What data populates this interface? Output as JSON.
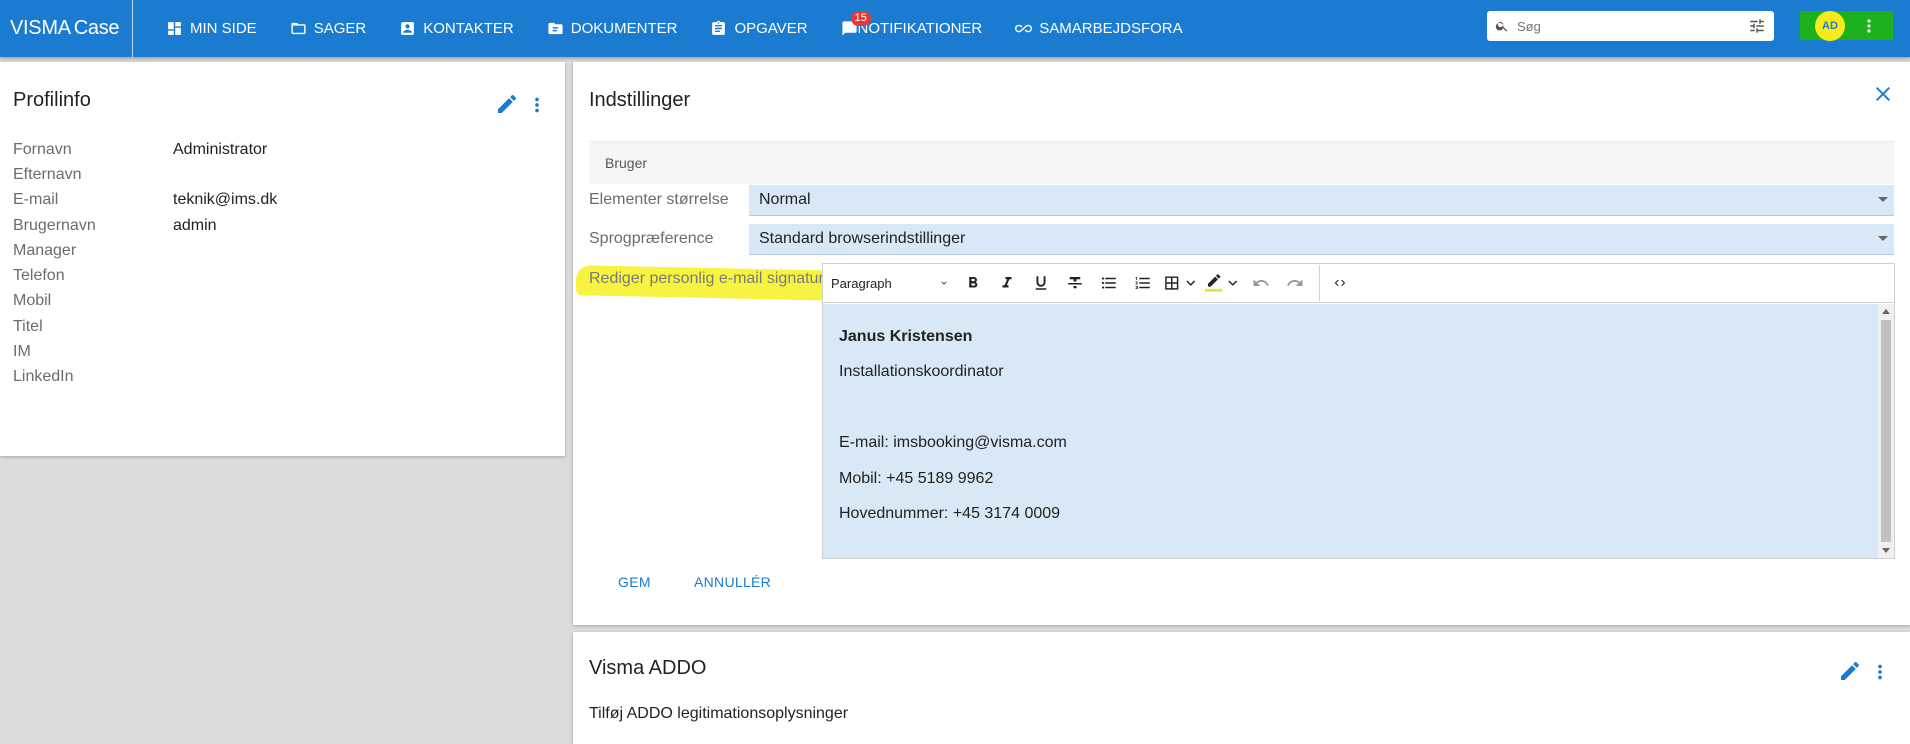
{
  "app": {
    "logo_brand": "VISMA",
    "logo_product": "Case"
  },
  "nav": [
    {
      "label": "MIN SIDE",
      "icon": "dashboard-icon"
    },
    {
      "label": "SAGER",
      "icon": "folder-icon"
    },
    {
      "label": "KONTAKTER",
      "icon": "contact-card-icon"
    },
    {
      "label": "DOKUMENTER",
      "icon": "document-folder-icon"
    },
    {
      "label": "OPGAVER",
      "icon": "clipboard-icon"
    },
    {
      "label": "NOTIFIKATIONER",
      "icon": "notification-icon",
      "badge": "15"
    },
    {
      "label": "SAMARBEJDSFORA",
      "icon": "infinity-icon"
    }
  ],
  "search": {
    "placeholder": "Søg"
  },
  "user": {
    "initials": "AD"
  },
  "profile": {
    "title": "Profilinfo",
    "fields": [
      {
        "label": "Fornavn",
        "value": "Administrator"
      },
      {
        "label": "Efternavn",
        "value": ""
      },
      {
        "label": "E-mail",
        "value": "teknik@ims.dk"
      },
      {
        "label": "Brugernavn",
        "value": "admin"
      },
      {
        "label": "Manager",
        "value": ""
      },
      {
        "label": "Telefon",
        "value": ""
      },
      {
        "label": "Mobil",
        "value": ""
      },
      {
        "label": "Titel",
        "value": ""
      },
      {
        "label": "IM",
        "value": ""
      },
      {
        "label": "LinkedIn",
        "value": ""
      }
    ]
  },
  "settings": {
    "title": "Indstillinger",
    "section": "Bruger",
    "size_label": "Elementer størrelse",
    "size_value": "Normal",
    "lang_label": "Sprogpræference",
    "lang_value": "Standard browserindstillinger",
    "signature_label": "Rediger personlig e-mail signatur",
    "editor": {
      "block_format": "Paragraph",
      "lines": [
        "Janus Kristensen",
        "Installationskoordinator",
        "",
        "E-mail: imsbooking@visma.com",
        "Mobil: +45 5189 9962",
        "Hovednummer: +45 3174 0009"
      ]
    },
    "save_label": "GEM",
    "cancel_label": "ANNULLÉR"
  },
  "addo": {
    "title": "Visma ADDO",
    "text": "Tilføj ADDO legitimationsoplysninger"
  },
  "colors": {
    "primary": "#1a7bd0",
    "field_bg": "#d8e8f6",
    "highlight": "#f7f340",
    "user_box": "#1db11d"
  }
}
